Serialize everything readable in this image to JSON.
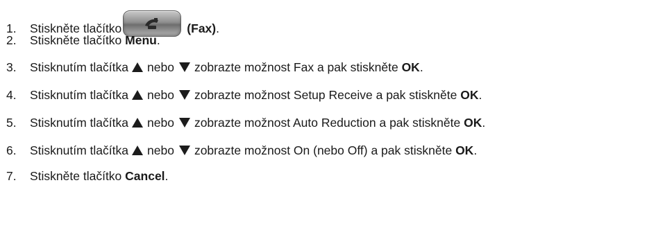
{
  "icons": {
    "fax_button": "fax-handset-icon",
    "up": "up-triangle-icon",
    "down": "down-triangle-icon"
  },
  "colors": {
    "text": "#1a1a1a",
    "arrow": "#1c1c1c"
  },
  "steps": [
    {
      "number": "1.",
      "before": "Stiskněte tlačítko",
      "bold": "(Fax)",
      "after": "."
    },
    {
      "number": "2.",
      "before": "Stiskněte tlačítko ",
      "bold": "Menu",
      "after": "."
    },
    {
      "number": "3.",
      "lead": "Stisknutím tlačítka",
      "mid": "nebo",
      "text": "zobrazte možnost Fax a pak stiskněte ",
      "bold": "OK",
      "after": "."
    },
    {
      "number": "4.",
      "lead": "Stisknutím tlačítka",
      "mid": "nebo",
      "text": "zobrazte možnost Setup Receive a pak stiskněte ",
      "bold": "OK",
      "after": "."
    },
    {
      "number": "5.",
      "lead": "Stisknutím tlačítka",
      "mid": "nebo",
      "text": "zobrazte možnost Auto Reduction a pak stiskněte ",
      "bold": "OK",
      "after": "."
    },
    {
      "number": "6.",
      "lead": "Stisknutím tlačítka",
      "mid": "nebo",
      "text": "zobrazte možnost On (nebo Off) a pak stiskněte ",
      "bold": "OK",
      "after": "."
    },
    {
      "number": "7.",
      "before": "Stiskněte tlačítko ",
      "bold": "Cancel",
      "after": "."
    }
  ]
}
